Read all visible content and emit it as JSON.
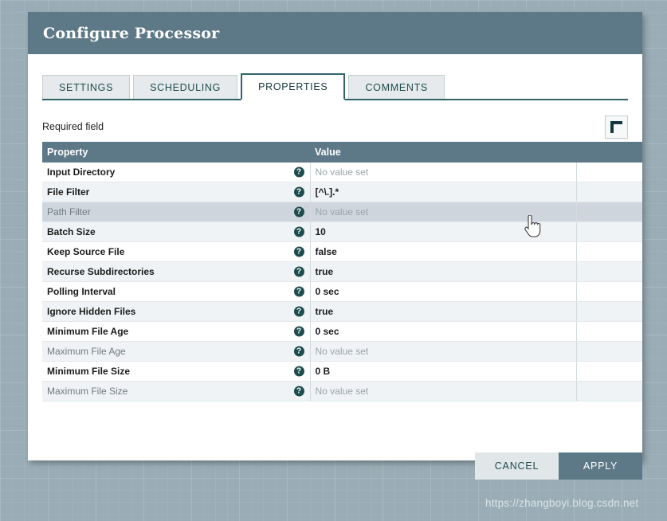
{
  "dialog": {
    "title": "Configure Processor",
    "header_color": "#5d7886"
  },
  "tabs": [
    {
      "label": "SETTINGS",
      "active": false
    },
    {
      "label": "SCHEDULING",
      "active": false
    },
    {
      "label": "PROPERTIES",
      "active": true
    },
    {
      "label": "COMMENTS",
      "active": false
    }
  ],
  "toolbar": {
    "required_field_label": "Required field",
    "add_button_icon": "plus-icon"
  },
  "table": {
    "columns": [
      "Property",
      "Value",
      ""
    ],
    "help_icon": "help-circle-icon",
    "unset_text": "No value set",
    "rows": [
      {
        "property": "Input Directory",
        "value": "No value set",
        "required": true,
        "value_set": false,
        "hover": false
      },
      {
        "property": "File Filter",
        "value": "[^\\.].*",
        "required": true,
        "value_set": true,
        "hover": false
      },
      {
        "property": "Path Filter",
        "value": "No value set",
        "required": false,
        "value_set": false,
        "hover": true
      },
      {
        "property": "Batch Size",
        "value": "10",
        "required": true,
        "value_set": true,
        "hover": false
      },
      {
        "property": "Keep Source File",
        "value": "false",
        "required": true,
        "value_set": true,
        "hover": false
      },
      {
        "property": "Recurse Subdirectories",
        "value": "true",
        "required": true,
        "value_set": true,
        "hover": false
      },
      {
        "property": "Polling Interval",
        "value": "0 sec",
        "required": true,
        "value_set": true,
        "hover": false
      },
      {
        "property": "Ignore Hidden Files",
        "value": "true",
        "required": true,
        "value_set": true,
        "hover": false
      },
      {
        "property": "Minimum File Age",
        "value": "0 sec",
        "required": true,
        "value_set": true,
        "hover": false
      },
      {
        "property": "Maximum File Age",
        "value": "No value set",
        "required": false,
        "value_set": false,
        "hover": false
      },
      {
        "property": "Minimum File Size",
        "value": "0 B",
        "required": true,
        "value_set": true,
        "hover": false
      },
      {
        "property": "Maximum File Size",
        "value": "No value set",
        "required": false,
        "value_set": false,
        "hover": false
      }
    ]
  },
  "footer": {
    "cancel_label": "CANCEL",
    "apply_label": "APPLY"
  },
  "watermark": {
    "text": "https://zhangboyi.blog.csdn.net"
  }
}
